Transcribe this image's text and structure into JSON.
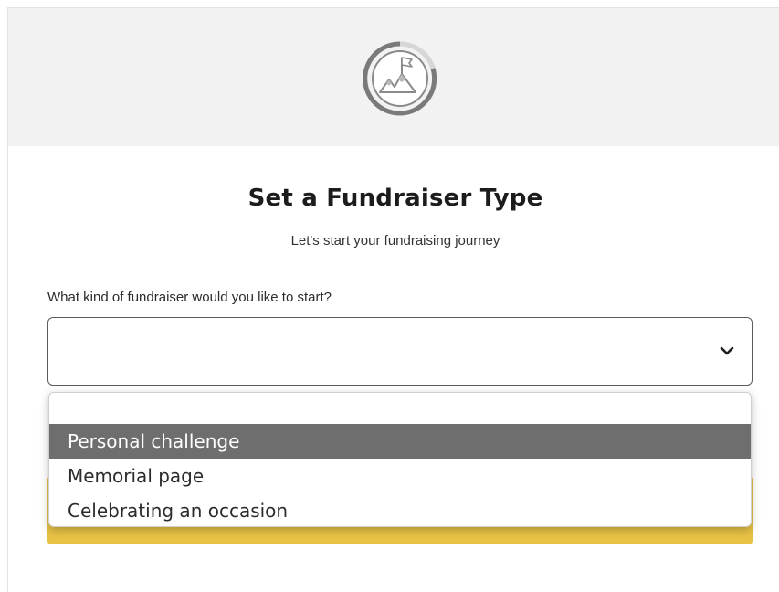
{
  "header": {
    "icon": "mountain-flag-progress-icon"
  },
  "page": {
    "title": "Set a Fundraiser Type",
    "subtitle": "Let's start your fundraising journey"
  },
  "form": {
    "question_label": "What kind of fundraiser would you like to start?",
    "selected_value": "",
    "options": [
      {
        "label": ""
      },
      {
        "label": "Personal challenge",
        "highlighted": true
      },
      {
        "label": "Memorial page"
      },
      {
        "label": "Celebrating an occasion"
      }
    ]
  },
  "colors": {
    "header_band": "#f2f2f2",
    "highlight": "#6e6e6e",
    "button_yellow": "#e8c244"
  }
}
